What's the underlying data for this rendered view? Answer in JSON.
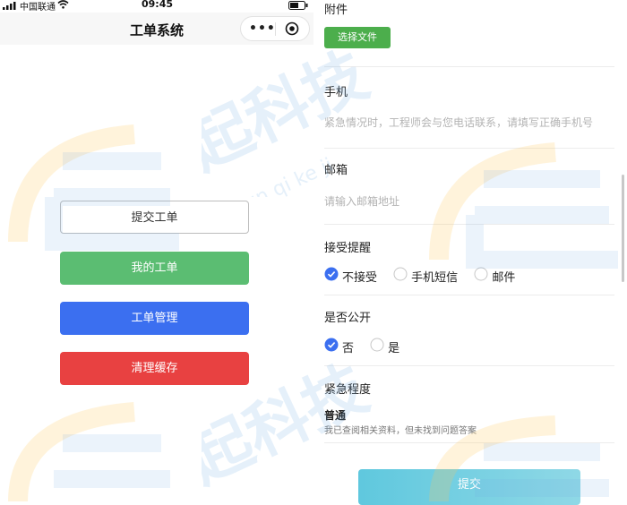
{
  "status_bar": {
    "carrier": "中国联通",
    "time": "09:45"
  },
  "nav": {
    "title": "工单系统",
    "more_icon": "more-dots-icon",
    "close_icon": "target-close-icon"
  },
  "home_buttons": {
    "submit_ticket": "提交工单",
    "my_tickets": "我的工单",
    "ticket_management": "工单管理",
    "clear_cache": "清理缓存"
  },
  "form": {
    "attachment": {
      "label": "附件",
      "button": "选择文件"
    },
    "phone": {
      "label": "手机",
      "placeholder": "紧急情况时，工程师会与您电话联系，请填写正确手机号"
    },
    "email": {
      "label": "邮箱",
      "placeholder": "请输入邮箱地址"
    },
    "reminder": {
      "label": "接受提醒",
      "options": [
        {
          "label": "不接受",
          "checked": true
        },
        {
          "label": "手机短信",
          "checked": false
        },
        {
          "label": "邮件",
          "checked": false
        }
      ]
    },
    "public": {
      "label": "是否公开",
      "options": [
        {
          "label": "否",
          "checked": true
        },
        {
          "label": "是",
          "checked": false
        }
      ]
    },
    "urgency": {
      "label": "紧急程度",
      "value": "普通",
      "description": "我已查阅相关资料，但未找到问题答案"
    },
    "submit": "提交"
  },
  "colors": {
    "green": "#5bbd72",
    "blue": "#3b6ff0",
    "red": "#e84141",
    "file_button": "#4cae4c",
    "radio_checked": "#3b6ff0",
    "submit": "#6ccfe0"
  },
  "watermark": {
    "text": "起科技",
    "romanized": "yun qi ke ji"
  }
}
